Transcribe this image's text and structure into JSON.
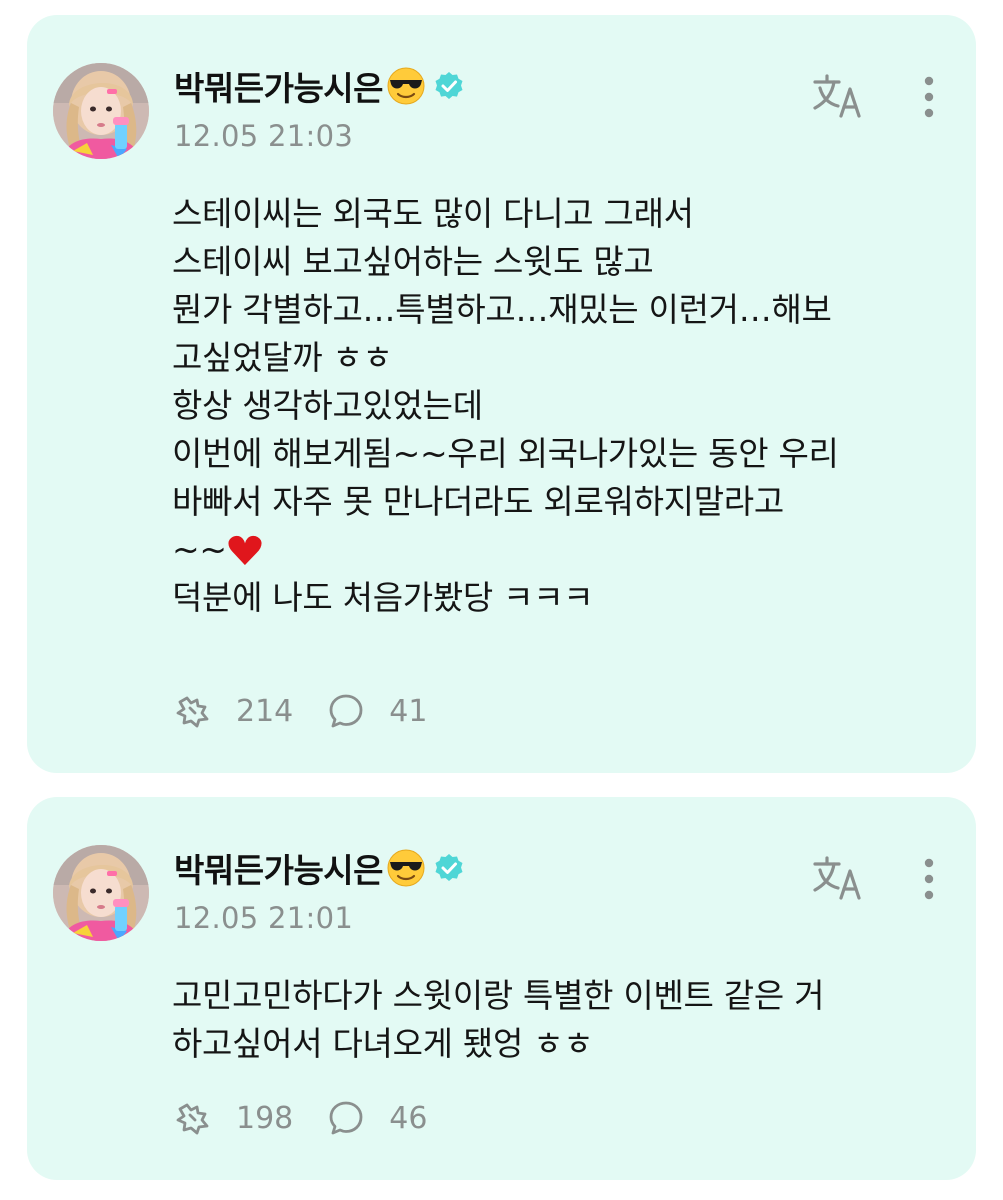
{
  "posts": [
    {
      "author": "박뭐든가능시은",
      "timestamp": "12.05 21:03",
      "lines": [
        "스테이씨는 외국도 많이 다니고 그래서",
        "스테이씨 보고싶어하는 스윗도 많고",
        "뭔가 각별하고…특별하고…재밌는 이런거…해보",
        "고싶었달까 ㅎㅎ",
        "항상 생각하고있었는데",
        "이번에 해보게됨~~우리 외국나가있는 동안 우리",
        "바빠서 자주 못 만나더라도 외로워하지말라고",
        "~~",
        "덕분에 나도 처음가봤당 ㅋㅋㅋ"
      ],
      "heart": "♥",
      "likes": "214",
      "comments": "41"
    },
    {
      "author": "박뭐든가능시은",
      "timestamp": "12.05 21:01",
      "lines": [
        "고민고민하다가 스윗이랑 특별한 이벤트 같은 거",
        "하고싶어서 다녀오게 됐엉 ㅎㅎ"
      ],
      "likes": "198",
      "comments": "46"
    }
  ],
  "colors": {
    "card_background": "#e3faf4",
    "icon_gray": "#8a8f8e",
    "verified_badge": "#4fd6d6",
    "heart": "#e0161c"
  },
  "icons": {
    "cool_emoji": "smiling-face-with-sunglasses",
    "verified": "verified-badge-icon",
    "translate": "translate-icon",
    "more": "more-vertical-icon",
    "like": "cheer-hand-icon",
    "comment": "comment-bubble-icon"
  }
}
